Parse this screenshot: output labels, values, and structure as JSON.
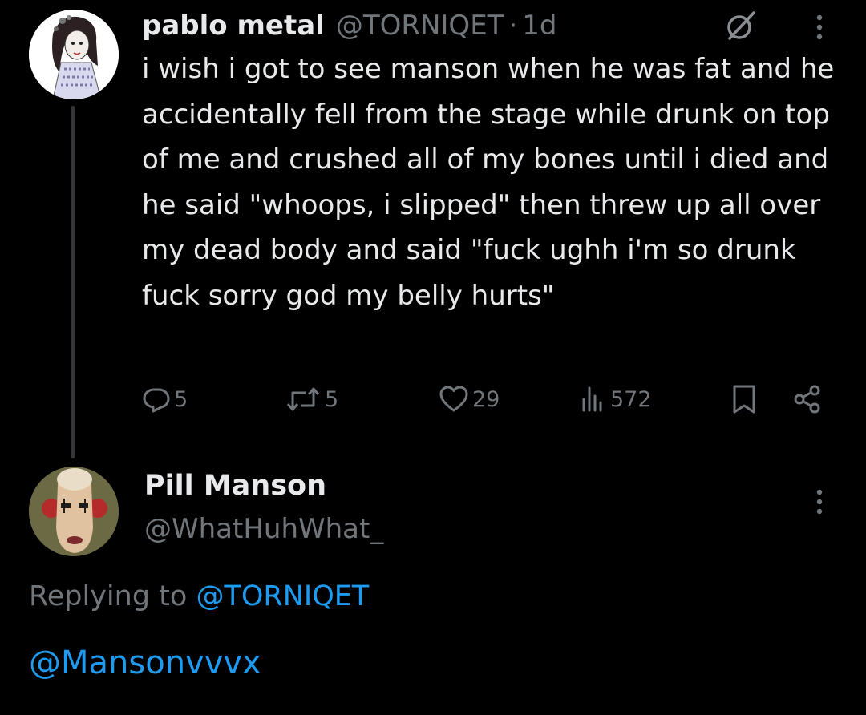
{
  "tweet1": {
    "author_name": "pablo metal",
    "author_handle": "@TORNIQET",
    "separator": "·",
    "time": "1d",
    "text": "i wish i got to see manson when he was fat and he accidentally fell from the stage while drunk on top of me and crushed all of my bones until i died and he said \"whoops, i slipped\" then threw up all over my dead body and said \"fuck ughh i'm so drunk fuck sorry god my belly hurts\"",
    "actions": {
      "replies": "5",
      "reposts": "5",
      "likes": "29",
      "views": "572"
    },
    "icons": [
      "avatar",
      "grok-icon",
      "more-icon",
      "reply-icon",
      "retweet-icon",
      "heart-icon",
      "views-icon",
      "bookmark-icon",
      "share-icon"
    ]
  },
  "tweet2": {
    "author_name": "Pill Manson",
    "author_handle": "@WhatHuhWhat_",
    "replying_prefix": "Replying to",
    "replying_to": "@TORNIQET",
    "text": "@Mansonvvvx",
    "icons": [
      "avatar",
      "more-icon"
    ]
  },
  "colors": {
    "background": "#000000",
    "primary_text": "#e7e9ea",
    "secondary_text": "#71767b",
    "accent": "#1d9bf0",
    "thread_line": "#333639"
  }
}
